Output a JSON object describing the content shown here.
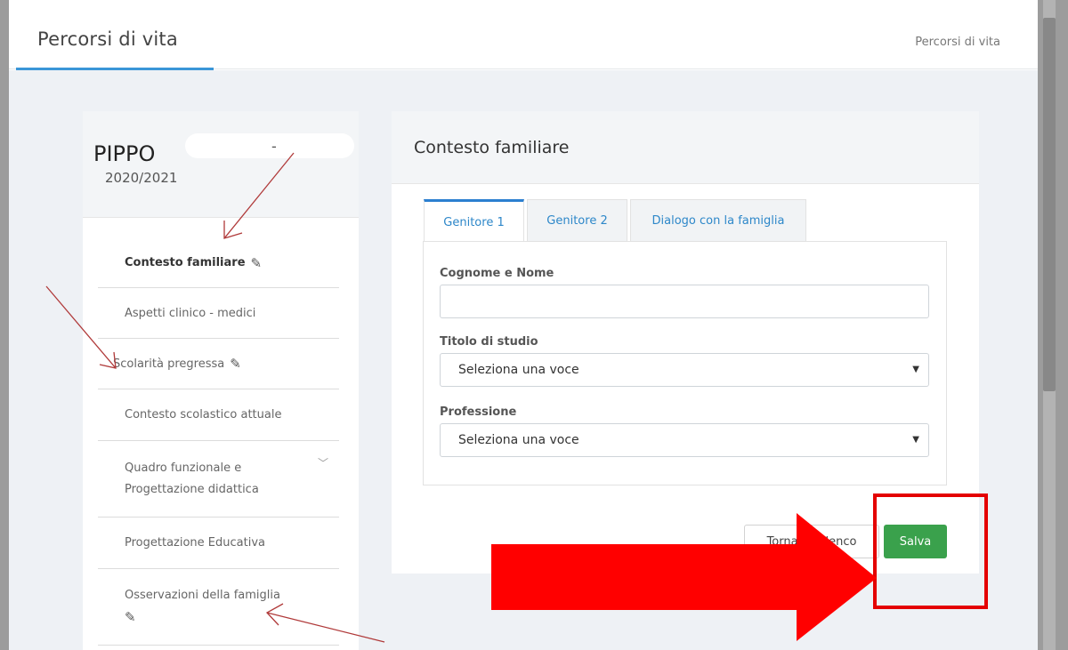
{
  "header": {
    "page_title": "Percorsi di vita",
    "breadcrumb": "Percorsi di vita"
  },
  "student": {
    "name": "PIPPO",
    "dash": "-",
    "school_year": "2020/2021"
  },
  "sidebar": {
    "items": [
      {
        "label": "Contesto familiare",
        "active": true,
        "edit_icon": "pencil-icon"
      },
      {
        "label": "Aspetti clinico - medici"
      },
      {
        "label": "Scolarità pregressa",
        "edit_icon": "pencil-icon"
      },
      {
        "label": "Contesto scolastico attuale"
      },
      {
        "label": "Quadro funzionale e Progettazione didattica",
        "expand_icon": "chevron-down-icon"
      },
      {
        "label": "Progettazione Educativa"
      },
      {
        "label": "Osservazioni della famiglia",
        "edit_icon": "pencil-icon"
      }
    ]
  },
  "form": {
    "title": "Contesto familiare",
    "tabs": [
      {
        "label": "Genitore 1",
        "active": true
      },
      {
        "label": "Genitore 2"
      },
      {
        "label": "Dialogo con la famiglia"
      }
    ],
    "fields": {
      "name_label": "Cognome e Nome",
      "name_value": "",
      "study_label": "Titolo di studio",
      "study_value": "Seleziona una voce",
      "job_label": "Professione",
      "job_value": "Seleziona una voce"
    },
    "back_label": "Torna all'elenco",
    "save_label": "Salva"
  },
  "colors": {
    "accent": "#3a96d8",
    "save_button": "#3aa14c",
    "annotation_red": "#e40000",
    "annotation_arrow_thin": "#b03a3a"
  }
}
